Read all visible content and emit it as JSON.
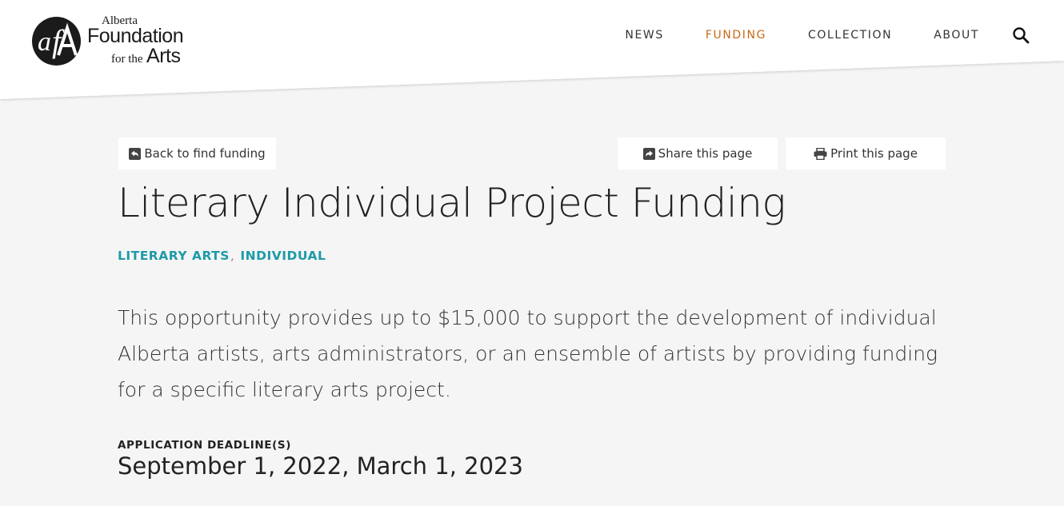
{
  "logo": {
    "line1": "Alberta",
    "line2": "Foundation",
    "line3a": "for the",
    "line3b": "Arts"
  },
  "nav": {
    "items": [
      {
        "label": "NEWS",
        "active": false
      },
      {
        "label": "FUNDING",
        "active": true
      },
      {
        "label": "COLLECTION",
        "active": false
      },
      {
        "label": "ABOUT",
        "active": false
      }
    ],
    "search_icon": "search-icon",
    "active_flag_color": "#f8c93a",
    "active_text_color": "#c76a16"
  },
  "toolbar": {
    "back_label": "Back to find funding",
    "share_label": "Share this page",
    "print_label": "Print this page"
  },
  "page": {
    "title": "Literary Individual Project Funding",
    "tags": [
      "LITERARY ARTS",
      "INDIVIDUAL"
    ],
    "tag_separator": ",",
    "tag_color": "#1d9aa8",
    "description": "This opportunity provides up to $15,000 to support the development of individual Alberta artists, arts administrators, or an ensemble of artists by providing funding for a specific literary arts project.",
    "deadline_label": "APPLICATION DEADLINE(S)",
    "deadline_value": "September 1, 2022, March 1, 2023"
  }
}
